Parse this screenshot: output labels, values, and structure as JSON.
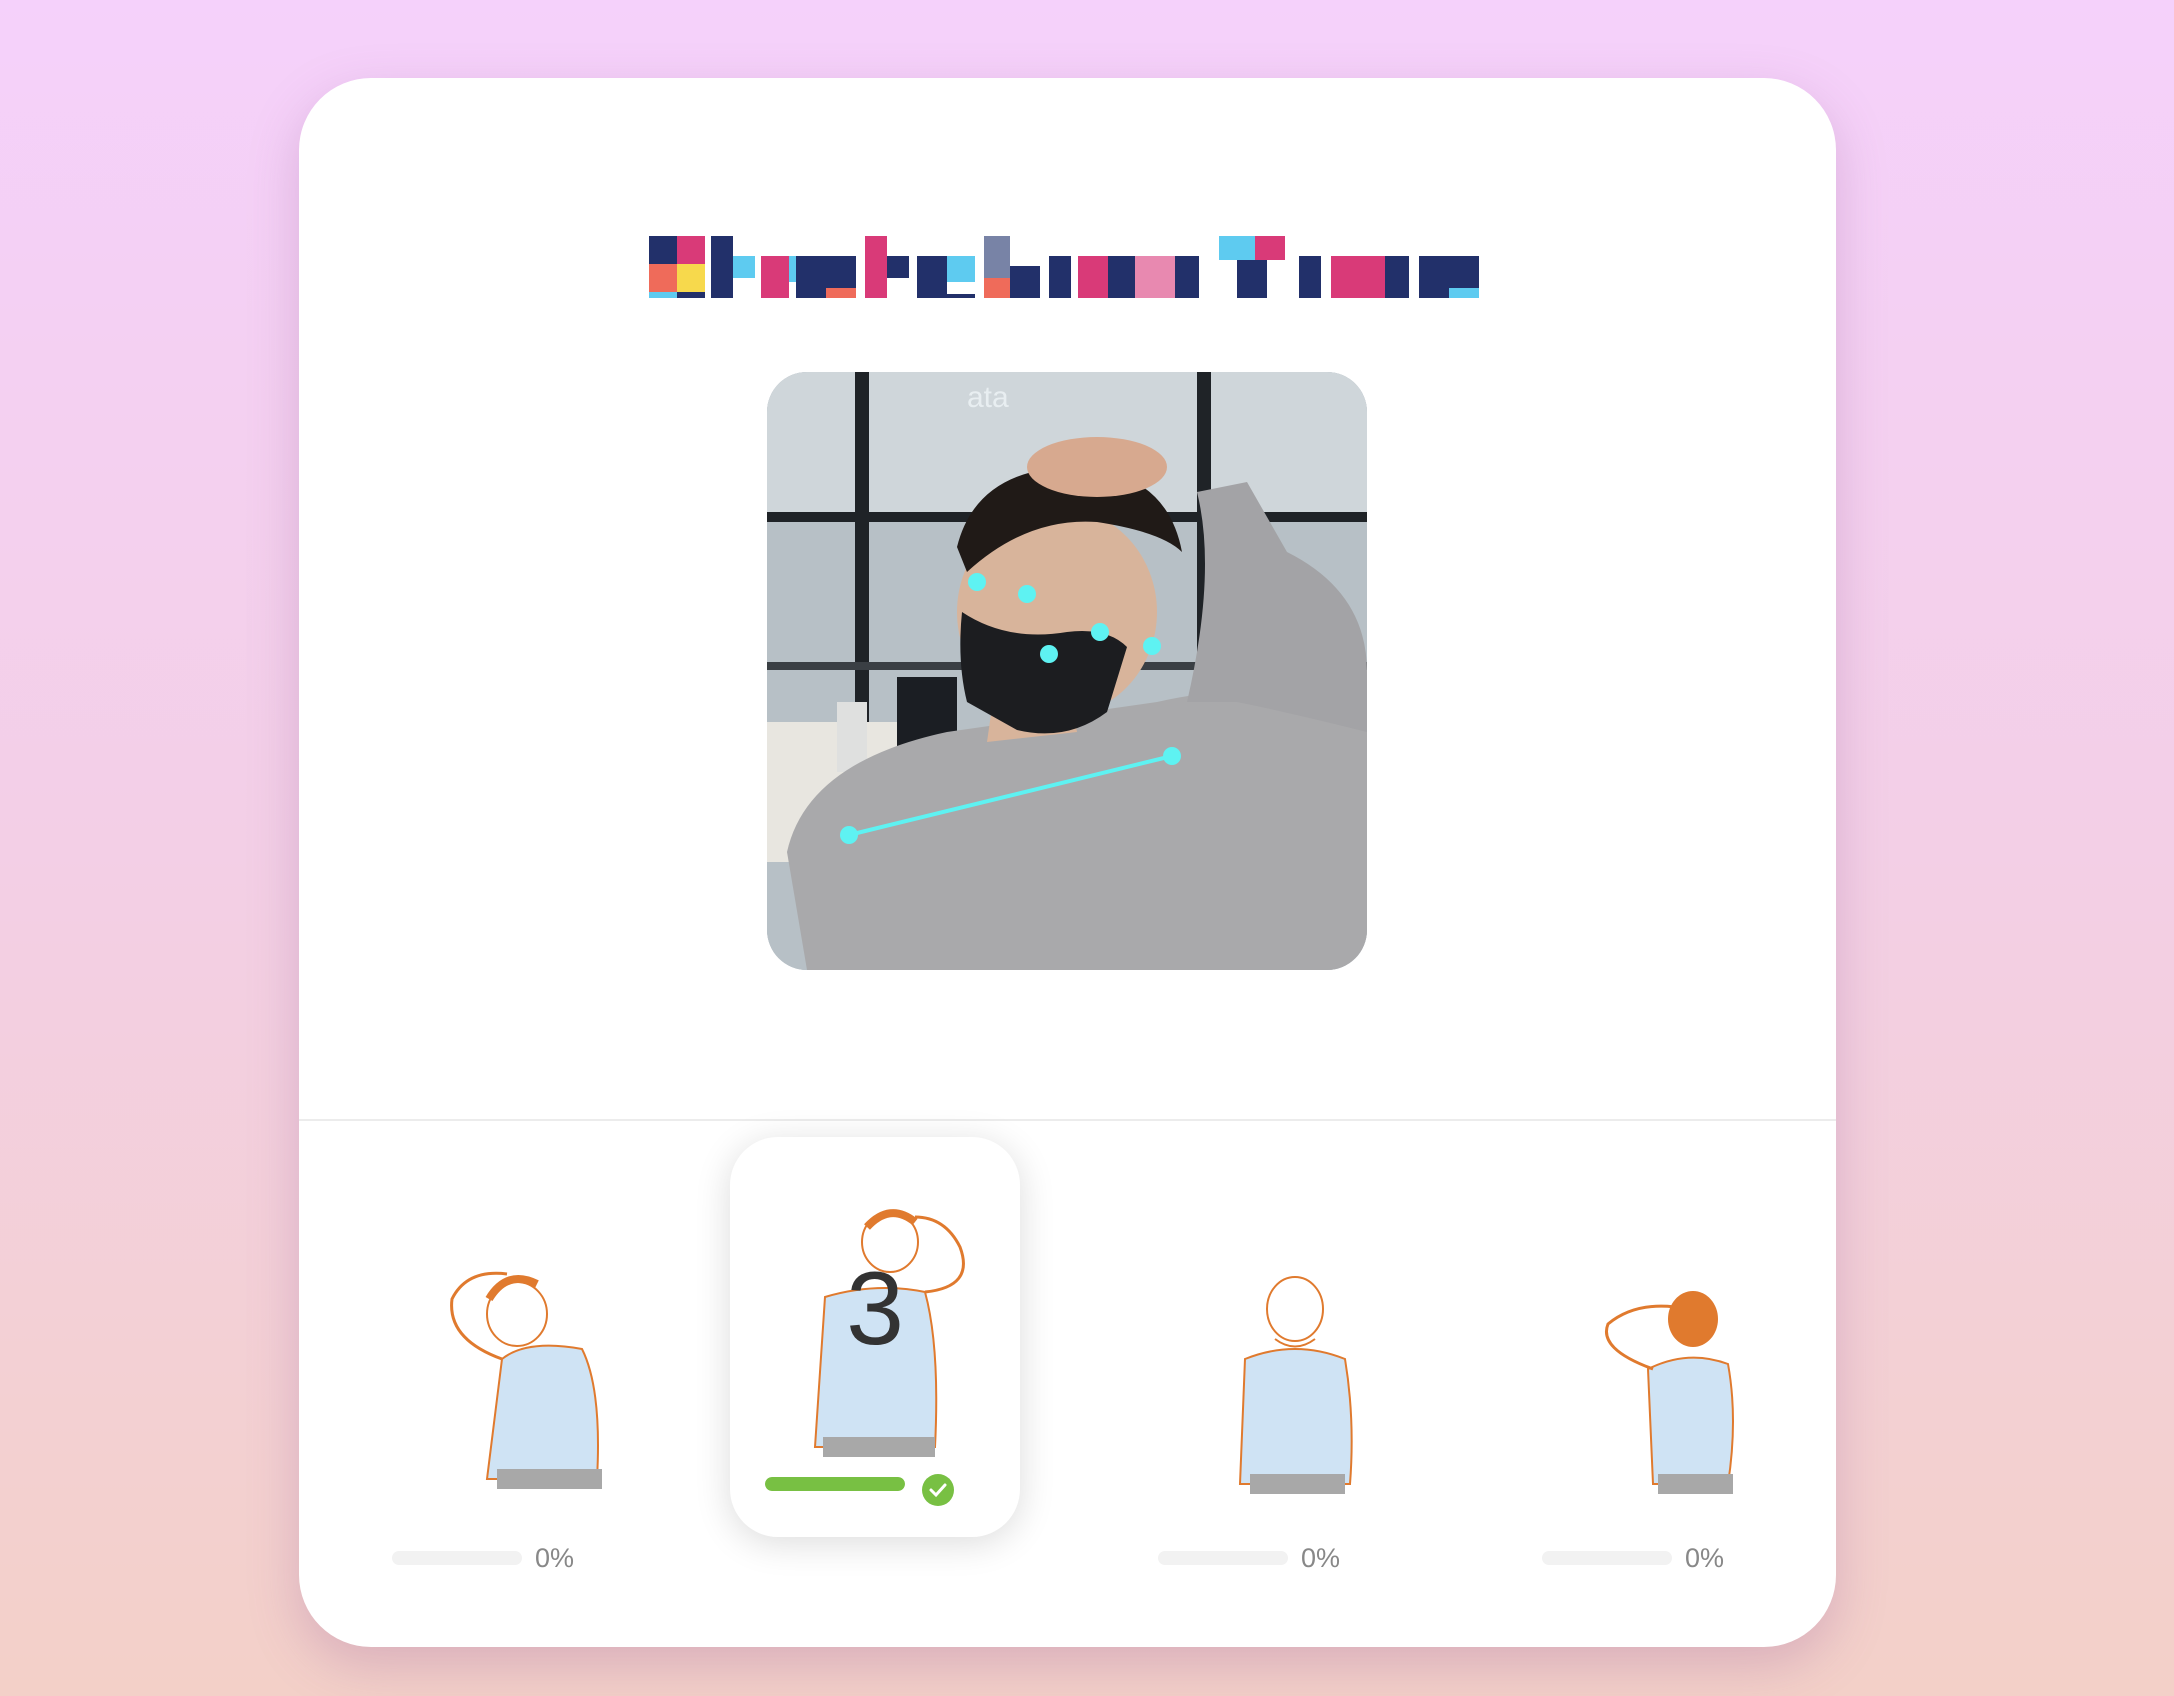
{
  "app": {
    "title": "Stretching Time",
    "colors": {
      "navy": "#22306a",
      "pink": "#d93a78",
      "cyan": "#5ecbf0",
      "yellow": "#f7d94c",
      "coral": "#ef6b5a",
      "progress_green": "#78c043",
      "keypoint_cyan": "#5ef2f2"
    }
  },
  "camera": {
    "label": "webcam-pose-feed",
    "watermark": "ata"
  },
  "exercises": [
    {
      "name": "head-tilt-left-figure",
      "progress": 0,
      "progress_label": "0%",
      "active": false
    },
    {
      "name": "head-tilt-right-figure",
      "progress": 1.0,
      "countdown": "3",
      "completed": true,
      "active": true
    },
    {
      "name": "neck-back-figure",
      "progress": 0,
      "progress_label": "0%",
      "active": false
    },
    {
      "name": "hands-behind-head-figure",
      "progress": 0,
      "progress_label": "0%",
      "active": false
    }
  ]
}
